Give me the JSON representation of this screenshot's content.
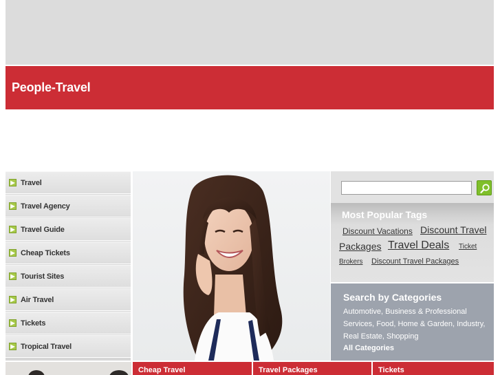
{
  "site": {
    "title": "People-Travel"
  },
  "sidebar": {
    "items": [
      {
        "label": "Travel"
      },
      {
        "label": "Travel Agency"
      },
      {
        "label": "Travel Guide"
      },
      {
        "label": "Cheap Tickets"
      },
      {
        "label": "Tourist Sites"
      },
      {
        "label": "Air Travel"
      },
      {
        "label": "Tickets"
      },
      {
        "label": "Tropical Travel"
      }
    ]
  },
  "search": {
    "value": "",
    "placeholder": ""
  },
  "tags": {
    "title": "Most Popular Tags",
    "items": [
      {
        "label": "Discount Vacations"
      },
      {
        "label": "Discount Travel"
      },
      {
        "label": "Packages"
      },
      {
        "label": "Travel Deals"
      },
      {
        "label": "Ticket"
      },
      {
        "label": "Brokers"
      },
      {
        "label": "Discount Travel Packages"
      }
    ]
  },
  "categories": {
    "title": "Search by Categories",
    "text": "Automotive, Business & Professional Services, Food, Home & Garden, Industry, Real Estate, Shopping",
    "all_label": "All Categories"
  },
  "bottom_tabs": [
    {
      "label": "Cheap Travel"
    },
    {
      "label": "Travel Packages"
    },
    {
      "label": "Tickets"
    }
  ],
  "colors": {
    "brand_red": "#cc2d35",
    "search_green": "#7fbf2a",
    "categories_bg": "#9da3ad"
  },
  "icons": {
    "nav": "arrow-box-icon",
    "search": "magnifier-icon"
  }
}
